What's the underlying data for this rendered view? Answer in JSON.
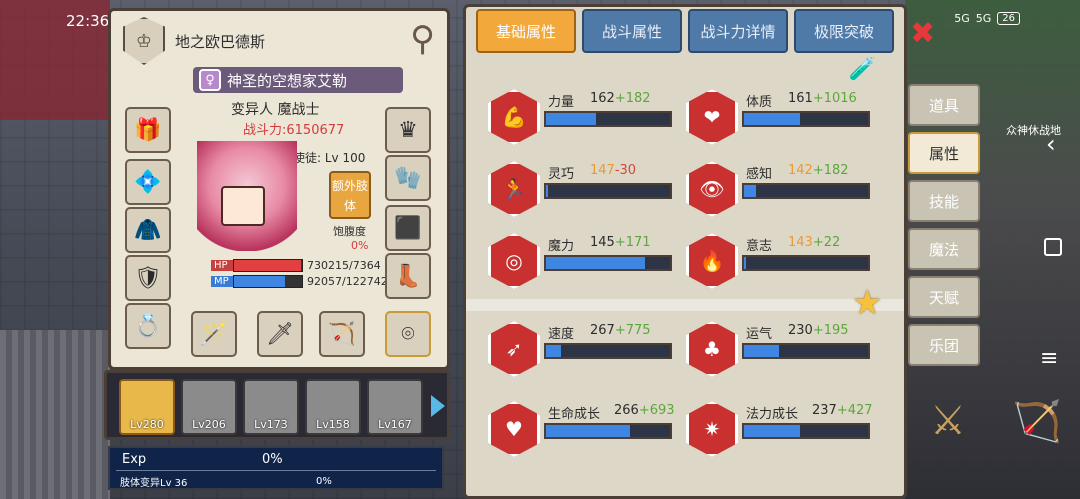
{
  "status": {
    "time": "22:36",
    "signal1": "5G",
    "signal2": "5G",
    "battery": "26"
  },
  "character": {
    "guild_name": "地之欧巴德斯",
    "title": "神圣的空想家艾勒",
    "class_name": "变异人 魔战士",
    "combat_power": "战斗力:6150677",
    "level_text": "狱使徒: Lv 100",
    "extra_limb_label": "额外肢体",
    "satiety_label": "饱腹度",
    "satiety_value": "0%",
    "hp_label": "HP",
    "hp_value": "730215/7364",
    "hp_fill": 0.99,
    "mp_label": "MP",
    "mp_value": "92057/122742",
    "mp_fill": 0.75
  },
  "party": [
    {
      "level": "Lv280",
      "active": true
    },
    {
      "level": "Lv206",
      "active": false
    },
    {
      "level": "Lv173",
      "active": false
    },
    {
      "level": "Lv158",
      "active": false
    },
    {
      "level": "Lv167",
      "active": false
    }
  ],
  "exp": {
    "label": "Exp",
    "percent": "0%",
    "limb_label": "肢体变异Lv 36",
    "limb_percent": "0%"
  },
  "tabs": [
    "基础属性",
    "战斗属性",
    "战斗力详情",
    "极限突破"
  ],
  "active_tab": "基础属性",
  "stats": [
    {
      "name": "力量",
      "base": "162",
      "bonus": "+182",
      "fill": 0.4,
      "icon": "strength-icon",
      "base_warn": false,
      "neg": false
    },
    {
      "name": "体质",
      "base": "161",
      "bonus": "+1016",
      "fill": 0.45,
      "icon": "constitution-icon",
      "base_warn": false,
      "neg": false
    },
    {
      "name": "灵巧",
      "base": "147",
      "bonus": "-30",
      "fill": 0.02,
      "icon": "agility-icon",
      "base_warn": true,
      "neg": true
    },
    {
      "name": "感知",
      "base": "142",
      "bonus": "+182",
      "fill": 0.1,
      "icon": "perception-icon",
      "base_warn": true,
      "neg": false
    },
    {
      "name": "魔力",
      "base": "145",
      "bonus": "+171",
      "fill": 0.8,
      "icon": "magic-icon",
      "base_warn": false,
      "neg": false
    },
    {
      "name": "意志",
      "base": "143",
      "bonus": "+22",
      "fill": 0.02,
      "icon": "will-icon",
      "base_warn": true,
      "neg": false
    },
    {
      "name": "速度",
      "base": "267",
      "bonus": "+775",
      "fill": 0.12,
      "icon": "speed-icon",
      "base_warn": false,
      "neg": false
    },
    {
      "name": "运气",
      "base": "230",
      "bonus": "+195",
      "fill": 0.28,
      "icon": "luck-icon",
      "base_warn": false,
      "neg": false
    },
    {
      "name": "生命成长",
      "base": "266",
      "bonus": "+693",
      "fill": 0.68,
      "icon": "life-growth-icon",
      "base_warn": false,
      "neg": false
    },
    {
      "name": "法力成长",
      "base": "237",
      "bonus": "+427",
      "fill": 0.45,
      "icon": "mana-growth-icon",
      "base_warn": false,
      "neg": false
    }
  ],
  "side_menu": [
    "道具",
    "属性",
    "技能",
    "魔法",
    "天赋",
    "乐团"
  ],
  "side_menu_active": "属性",
  "map_label": "众神休战地"
}
